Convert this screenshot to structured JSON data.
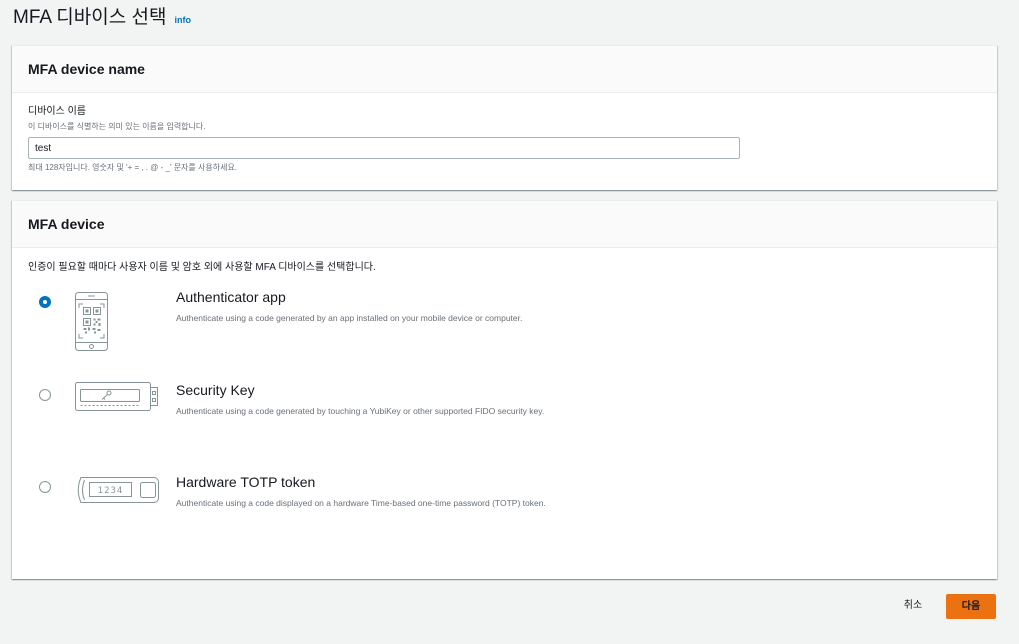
{
  "page": {
    "title": "MFA 디바이스 선택",
    "info_link": "info"
  },
  "device_name_panel": {
    "header": "MFA device name",
    "field_label": "디바이스 이름",
    "field_description": "이 디바이스를 식별하는 의미 있는 이름을 입력합니다.",
    "field_value": "test",
    "field_hint": "최대 128자입니다. 영숫자 및 '+ = , . @ - _' 문자를 사용하세요."
  },
  "device_panel": {
    "header": "MFA device",
    "intro": "인증이 필요할 때마다 사용자 이름 및 암호 외에 사용할 MFA 디바이스를 선택합니다.",
    "options": [
      {
        "title": "Authenticator app",
        "description": "Authenticate using a code generated by an app installed on your mobile device or computer.",
        "icon": "phone-qr-icon",
        "selected": true
      },
      {
        "title": "Security Key",
        "description": "Authenticate using a code generated by touching a YubiKey or other supported FIDO security key.",
        "icon": "usb-security-key-icon",
        "selected": false
      },
      {
        "title": "Hardware TOTP token",
        "description": "Authenticate using a code displayed on a hardware Time-based one-time password (TOTP) token.",
        "icon": "totp-token-icon",
        "icon_display_text": "1234",
        "selected": false
      }
    ]
  },
  "footer": {
    "cancel_label": "취소",
    "next_label": "다음"
  },
  "colors": {
    "page_background": "#f2f3f3",
    "panel_background": "#ffffff",
    "panel_header_background": "#fafafa",
    "text_primary": "#16191f",
    "text_secondary": "#687078",
    "link": "#0073bb",
    "radio_selected": "#0073bb",
    "radio_unselected": "#879596",
    "primary_button": "#ec7211",
    "primary_button_text": "#16191f",
    "icon_stroke": "#879596",
    "divider": "#eaeded",
    "input_border": "#aab7b8"
  }
}
